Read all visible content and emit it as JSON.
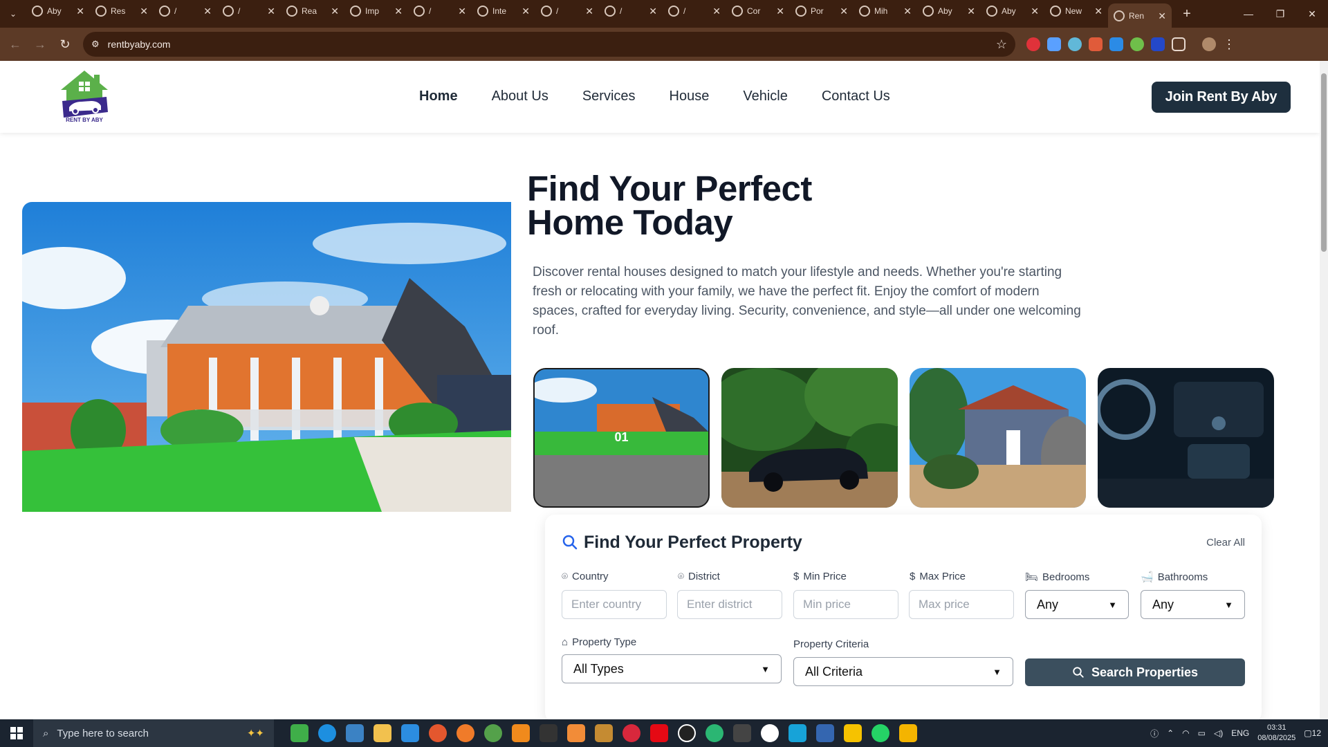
{
  "browser": {
    "tabs": [
      {
        "title": "Aby"
      },
      {
        "title": "Res"
      },
      {
        "title": "/"
      },
      {
        "title": "/"
      },
      {
        "title": "Rea"
      },
      {
        "title": "Imp"
      },
      {
        "title": "/"
      },
      {
        "title": "Inte"
      },
      {
        "title": "/"
      },
      {
        "title": "/"
      },
      {
        "title": "/"
      },
      {
        "title": "Cor"
      },
      {
        "title": "Por"
      },
      {
        "title": "Mih"
      },
      {
        "title": "Aby"
      },
      {
        "title": "Aby"
      },
      {
        "title": "New"
      },
      {
        "title": "Ren"
      }
    ],
    "url": "rentbyaby.com"
  },
  "site": {
    "logo_text": "RENT BY ABY",
    "nav": [
      "Home",
      "About Us",
      "Services",
      "House",
      "Vehicle",
      "Contact Us"
    ],
    "join_label": "Join Rent By Aby"
  },
  "hero": {
    "title": "Find Your Perfect Home Today",
    "description": "Discover rental houses designed to match your lifestyle and needs. Whether you're starting fresh or relocating with your family, we have the perfect fit. Enjoy the comfort of modern spaces, crafted for everyday living. Security, convenience, and style—all under one welcoming roof.",
    "slide_number": "01"
  },
  "search": {
    "title": "Find Your Perfect Property",
    "clear_label": "Clear All",
    "country": {
      "label": "Country",
      "placeholder": "Enter country"
    },
    "district": {
      "label": "District",
      "placeholder": "Enter district"
    },
    "min_price": {
      "label": "Min Price",
      "placeholder": "Min price"
    },
    "max_price": {
      "label": "Max Price",
      "placeholder": "Max price"
    },
    "bedrooms": {
      "label": "Bedrooms",
      "value": "Any"
    },
    "bathrooms": {
      "label": "Bathrooms",
      "value": "Any"
    },
    "property_type": {
      "label": "Property Type",
      "value": "All Types"
    },
    "property_criteria": {
      "label": "Property Criteria",
      "value": "All Criteria"
    },
    "button_label": "Search Properties"
  },
  "taskbar": {
    "search_placeholder": "Type here to search",
    "language": "ENG",
    "time": "03:31",
    "date": "08/08/2025",
    "notifications": "12"
  }
}
